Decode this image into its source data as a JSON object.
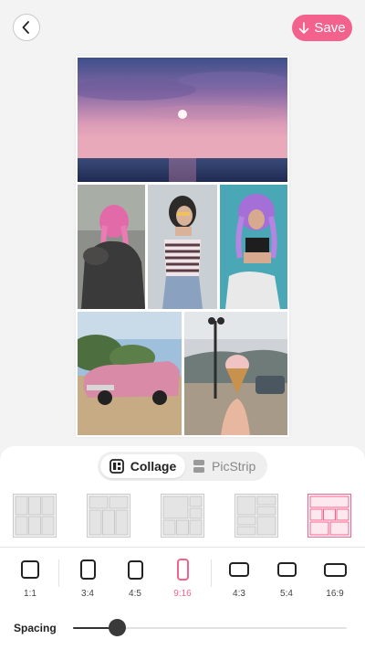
{
  "header": {
    "back_icon": "chevron-left-icon",
    "save_label": "Save",
    "save_icon": "download-arrow-icon",
    "accent_color": "#f2628d"
  },
  "collage_photos": [
    "sunset-over-sea",
    "pink-braids-jacket",
    "woman-striped-top",
    "purple-braids-phone",
    "pink-vintage-car",
    "ice-cream-cone-street"
  ],
  "mode_toggle": {
    "options": [
      "Collage",
      "PicStrip"
    ],
    "selected": "Collage"
  },
  "layout_options": {
    "count": 5,
    "selected_index": 4
  },
  "aspect_ratios": {
    "options": [
      "1:1",
      "3:4",
      "4:5",
      "9:16",
      "4:3",
      "5:4",
      "16:9"
    ],
    "selected": "9:16"
  },
  "spacing": {
    "label": "Spacing",
    "value": 0.16
  }
}
